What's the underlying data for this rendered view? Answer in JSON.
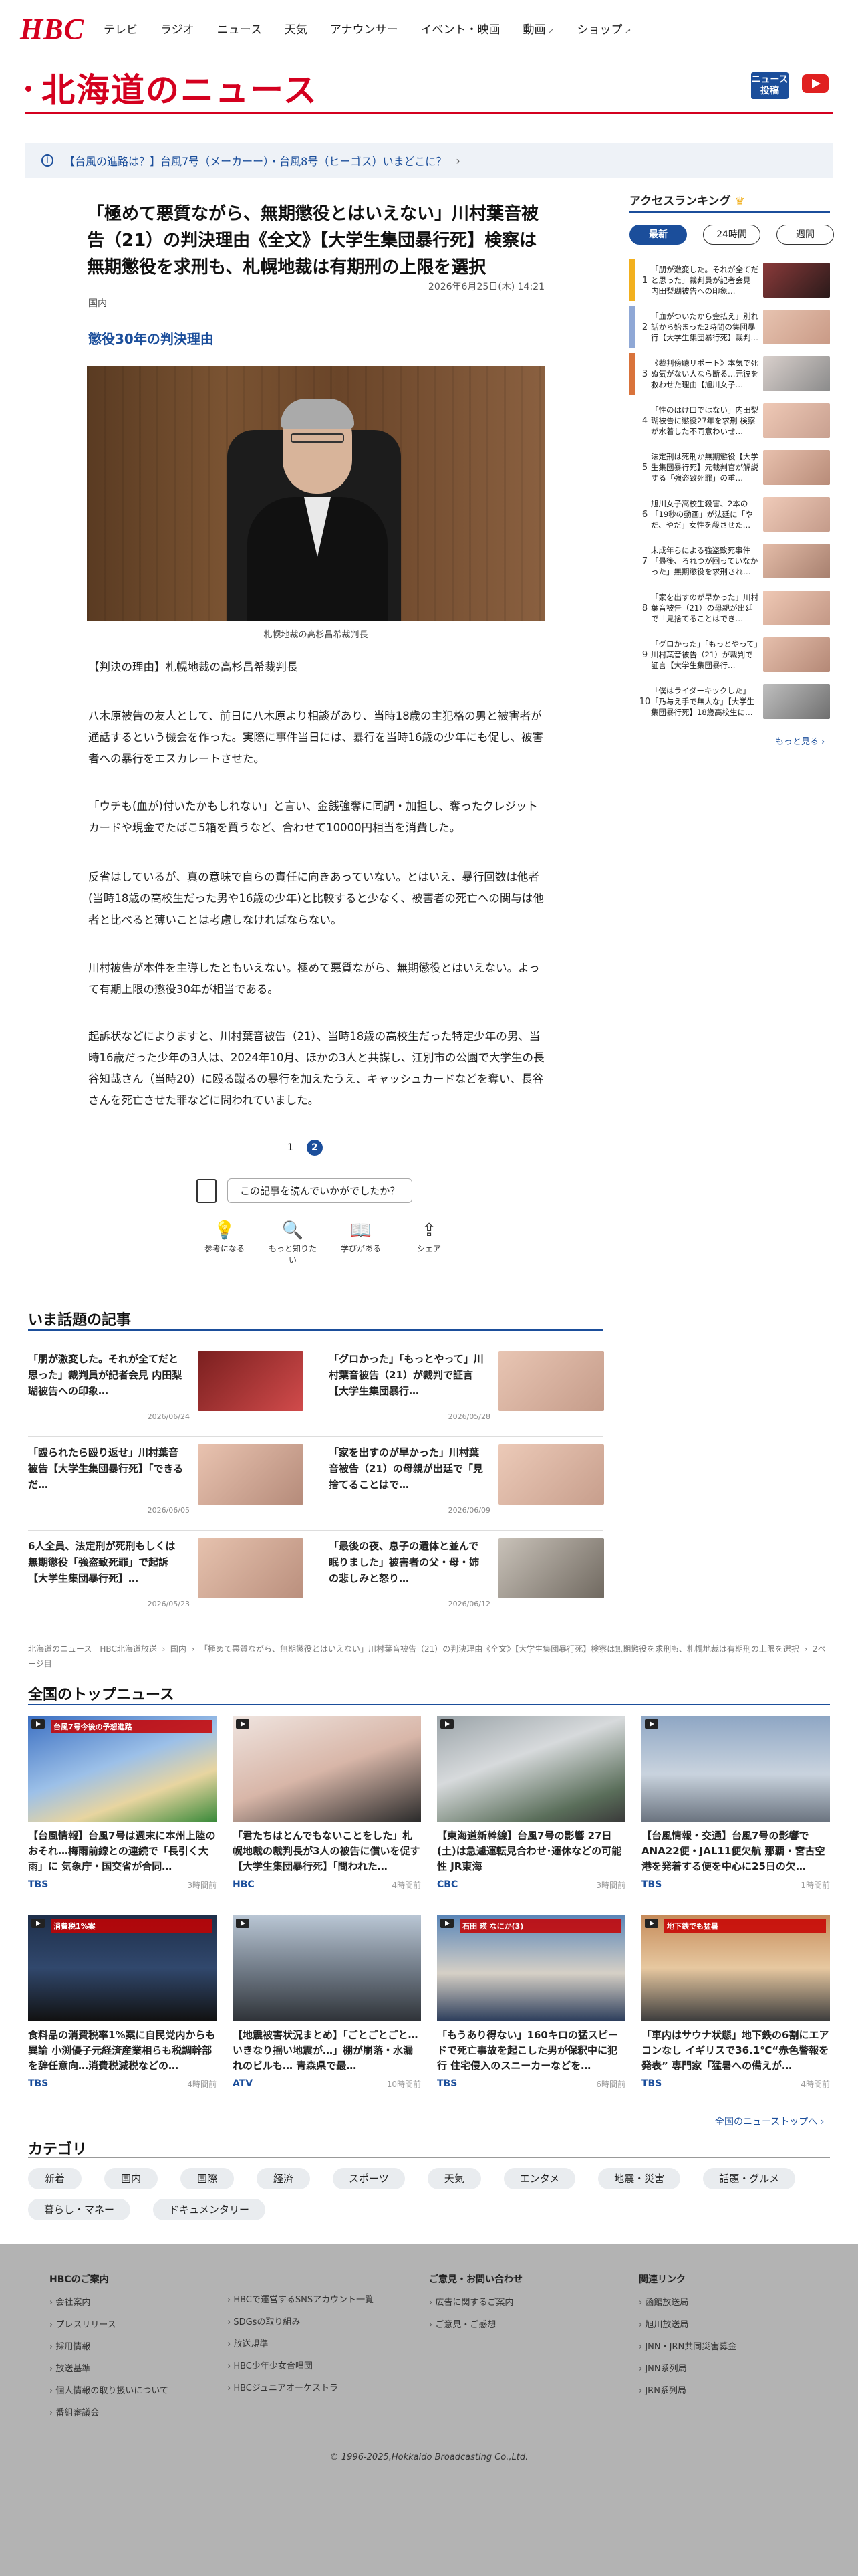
{
  "header": {
    "logo": "HBC",
    "nav": [
      "テレビ",
      "ラジオ",
      "ニュース",
      "天気",
      "アナウンサー",
      "イベント・映画",
      "動画",
      "ショップ"
    ],
    "site_title": "北海道のニュース",
    "news_badge_line1": "ニュース",
    "news_badge_line2": "投稿"
  },
  "alert": {
    "text": "【台風の進路は？】台風7号（メーカーー）・台風8号（ヒーゴス）いまどこに？"
  },
  "article": {
    "title": "「極めて悪質ながら、無期懲役とはいえない」川村葉音被告（21）の判決理由《全文》【大学生集団暴行死】検察は無期懲役を求刑も、札幌地裁は有期刑の上限を選択",
    "date": "2026年6月25日(木) 14:21",
    "tag": "国内",
    "subhead": "懲役30年の判決理由",
    "caption": "札幌地裁の高杉昌希裁判長",
    "paragraphs": [
      "【判決の理由】札幌地裁の高杉昌希裁判長",
      "八木原被告の友人として、前日に八木原より相談があり、当時18歳の主犯格の男と被害者が通話するという機会を作った。実際に事件当日には、暴行を当時16歳の少年にも促し、被害者への暴行をエスカレートさせた。",
      "「ウチも(血が)付いたかもしれない」と言い、金銭強奪に同調・加担し、奪ったクレジットカードや現金でたばこ5箱を買うなど、合わせて10000円相当を消費した。",
      "反省はしているが、真の意味で自らの責任に向きあっていない。とはいえ、暴行回数は他者(当時18歳の高校生だった男や16歳の少年)と比較すると少なく、被害者の死亡への関与は他者と比べると薄いことは考慮しなければならない。",
      "川村被告が本件を主導したともいえない。極めて悪質ながら、無期懲役とはいえない。よって有期上限の懲役30年が相当である。",
      "起訴状などによりますと、川村葉音被告（21）、当時18歳の高校生だった特定少年の男、当時16歳だった少年の3人は、2024年10月、ほかの3人と共謀し、江別市の公園で大学生の長谷知哉さん（当時20）に殴る蹴るの暴行を加えたうえ、キャッシュカードなどを奪い、長谷さんを死亡させた罪などに問われていました。"
    ],
    "pages": [
      "1",
      "2"
    ],
    "survey_label": "この記事を読んでいかがでしたか？",
    "reactions": [
      "参考になる",
      "もっと知りたい",
      "学びがある",
      "シェア"
    ]
  },
  "ranking": {
    "title": "アクセスランキング",
    "tabs": [
      "最新",
      "24時間",
      "週間"
    ],
    "items": [
      {
        "num": "1",
        "text": "「朋が激変した。それが全てだと思った」裁判員が記者会見 内田梨瑚被告への印象…",
        "color": "#f2b01e"
      },
      {
        "num": "2",
        "text": "「血がついたから金払え」別れ話から始まった2時間の集団暴行【大学生集団暴行死】裁判…",
        "color": "#8fa8d6"
      },
      {
        "num": "3",
        "text": "《裁判傍聴リポート》本気で死ぬ気がない人なら断る…元彼を救わせた理由【旭川女子…",
        "color": "#d9733b"
      },
      {
        "num": "4",
        "text": "「性のはけ口ではない」内田梨瑚被告に懲役27年を求刑 検察が水着した不同意わいせ…",
        "color": "#fff"
      },
      {
        "num": "5",
        "text": "法定刑は死刑か無期懲役【大学生集団暴行死】元裁判官が解説する「強盗致死罪」の重…",
        "color": "#fff"
      },
      {
        "num": "6",
        "text": "旭川女子高校生殺害、2本の「19秒の動画」が法廷に「やだ、やだ」女性を殺させた…",
        "color": "#fff"
      },
      {
        "num": "7",
        "text": "未成年らによる強盗致死事件「最後、ろれつが回っていなかった」無期懲役を求刑され…",
        "color": "#fff"
      },
      {
        "num": "8",
        "text": "「家を出すのが早かった」川村葉音被告（21）の母親が出廷で「見捨てることはでき…",
        "color": "#fff"
      },
      {
        "num": "9",
        "text": "「グロかった」「もっとやって」川村葉音被告（21）が裁判で証言【大学生集団暴行…",
        "color": "#fff"
      },
      {
        "num": "10",
        "text": "「僕はライダーキックした」「乃与え手で無人な」【大学生集団暴行死】18歳高校生に…",
        "color": "#fff"
      }
    ],
    "more": "もっと見る"
  },
  "trending": {
    "title": "いま話題の記事",
    "items": [
      {
        "text": "「朋が激変した。それが全てだと思った」裁判員が記者会見 内田梨瑚被告への印象…",
        "date": "2026/06/24"
      },
      {
        "text": "「グロかった」「もっとやって」川村葉音被告（21）が裁判で証言【大学生集団暴行…",
        "date": "2026/05/28"
      },
      {
        "text": "「殴られたら殴り返せ」川村葉音被告【大学生集団暴行死】「できるだ…",
        "date": "2026/06/05"
      },
      {
        "text": "「家を出すのが早かった」川村葉音被告（21）の母親が出廷で「見捨てることはで…",
        "date": "2026/06/09"
      },
      {
        "text": "6人全員、法定刑が死刑もしくは無期懲役「強盗致死罪」で起訴【大学生集団暴行死】…",
        "date": "2026/05/23"
      },
      {
        "text": "「最後の夜、息子の遺体と並んで眠りました」被害者の父・母・姉の悲しみと怒り…",
        "date": "2026/06/12"
      }
    ]
  },
  "breadcrumb": {
    "items": [
      "北海道のニュース｜HBC北海道放送",
      "国内",
      "「極めて悪質ながら、無期懲役とはいえない」川村葉音被告（21）の判決理由《全文》【大学生集団暴行死】検察は無期懲役を求刑も、札幌地裁は有期刑の上限を選択",
      "2ページ目"
    ]
  },
  "top_news": {
    "title": "全国のトップニュース",
    "items": [
      {
        "caption": "【台風情報】台風7号は週末に本州上陸のおそれ…梅雨前線との連続で「長引く大雨」に 気象庁・国交省が合同…",
        "source": "TBS",
        "time": "3時間前"
      },
      {
        "caption": "「君たちはとんでもないことをした」札幌地裁の裁判長が3人の被告に償いを促す【大学生集団暴行死】「問われた…",
        "source": "HBC",
        "time": "4時間前"
      },
      {
        "caption": "【東海道新幹線】台風7号の影響 27日(土)は急遽運転見合わせ･運休などの可能性 JR東海",
        "source": "CBC",
        "time": "3時間前"
      },
      {
        "caption": "【台風情報・交通】台風7号の影響でANA22便・JAL11便欠航 那覇・宮古空港を発着する便を中心に25日の欠…",
        "source": "TBS",
        "time": "1時間前"
      },
      {
        "caption": "食料品の消費税率1%案に自民党内からも異論 小渕優子元経済産業相らも税調幹部を辞任意向…消費税減税などの…",
        "source": "TBS",
        "time": "4時間前"
      },
      {
        "caption": "【地震被害状況まとめ】「ごとごとごと…いきなり揺い地震が…」棚が崩落・水漏れのビルも… 青森県で最…",
        "source": "ATV",
        "time": "10時間前"
      },
      {
        "caption": "「もうあり得ない」160キロの猛スピードで死亡事故を起こした男が保釈中に犯行 住宅侵入のスニーカーなどを…",
        "source": "TBS",
        "time": "6時間前"
      },
      {
        "caption": "「車内はサウナ状態」地下鉄の6割にエアコンなし イギリスで36.1℃“赤色警報を発表” 専門家「猛暑への備えが…",
        "source": "TBS",
        "time": "4時間前"
      }
    ],
    "img_texts": [
      "台風7号今後の予想進路",
      "消費税1%案",
      "石田 瑛 なにか(3)",
      "地下鉄でも猛暑"
    ],
    "all_link": "全国のニューストップへ"
  },
  "categories": {
    "title": "カテゴリ",
    "items": [
      "新着",
      "国内",
      "国際",
      "経済",
      "スポーツ",
      "天気",
      "エンタメ",
      "地震・災害",
      "話題・グルメ",
      "暮らし・マネー",
      "ドキュメンタリー"
    ]
  },
  "footer": {
    "col1_title": "HBCのご案内",
    "col1": [
      "会社案内",
      "プレスリリース",
      "採用情報",
      "放送基準",
      "個人情報の取り扱いについて",
      "番組審議会",
      "HBCで運営するSNSアカウント一覧",
      "SDGsの取り組み",
      "放送規準",
      "HBC少年少女合唱団",
      "HBCジュニアオーケストラ"
    ],
    "col2_title": "ご意見・お問い合わせ",
    "col2": [
      "広告に関するご案内",
      "ご意見・ご感想"
    ],
    "col3_title": "関連リンク",
    "col3": [
      "函館放送局",
      "旭川放送局",
      "JNN・JRN共同災害募金",
      "JNN系列局",
      "JRN系列局"
    ],
    "copyright": "© 1996-2025,Hokkaido Broadcasting Co.,Ltd."
  },
  "colors": {
    "brand_red": "#d4001f",
    "accent_blue": "#1b4e9b"
  }
}
